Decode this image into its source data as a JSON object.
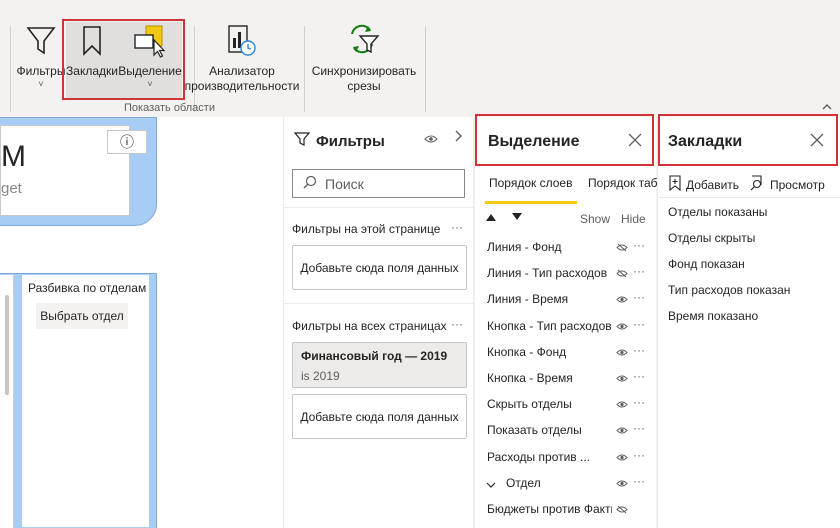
{
  "ribbon": {
    "filters_label": "Фильтры",
    "bookmarks_label": "Закладки",
    "selection_label": "Выделение",
    "analyzer_label_line1": "Анализатор",
    "analyzer_label_line2": "производительности",
    "sync_label_line1": "Синхронизировать",
    "sync_label_line2": "срезы",
    "group_label": "Показать области",
    "caret": "˅"
  },
  "canvas": {
    "card_big_text": "M",
    "card_sub_text": "get",
    "info_icon": "ⓘ",
    "slicer_title": "Разбивка по отделам",
    "slicer_button": "Выбрать отдел"
  },
  "filters": {
    "title": "Фильтры",
    "search_placeholder": "Поиск",
    "page_section": "Фильтры на этой странице",
    "all_section": "Фильтры на всех страницах",
    "dots": "···",
    "drop_hint": "Добавьте сюда поля данных",
    "card_title": "Финансовый год — 2019",
    "card_value": "is 2019"
  },
  "selection": {
    "title": "Выделение",
    "tab_layer_order": "Порядок слоев",
    "tab_tab_order": "Порядок табуляции",
    "show": "Show",
    "hide": "Hide",
    "rows": [
      {
        "name": "Линия - Фонд",
        "eye": "hidden"
      },
      {
        "name": "Линия - Тип расходов",
        "eye": "hidden"
      },
      {
        "name": "Линия - Время",
        "eye": "visible"
      },
      {
        "name": "Кнопка - Тип расходов",
        "eye": "visible"
      },
      {
        "name": "Кнопка - Фонд",
        "eye": "visible"
      },
      {
        "name": "Кнопка - Время",
        "eye": "visible"
      },
      {
        "name": "Скрыть отделы",
        "eye": "visible"
      },
      {
        "name": "Показать отделы",
        "eye": "visible"
      },
      {
        "name": "Расходы против ...",
        "eye": "visible"
      },
      {
        "name": "Отдел",
        "eye": "visible"
      },
      {
        "name": "Бюджеты против Факти...",
        "eye": "hidden"
      }
    ]
  },
  "bookmarks": {
    "title": "Закладки",
    "add_label": "Добавить",
    "view_label": "Просмотр",
    "items": [
      "Отделы показаны",
      "Отделы скрыты",
      "Фонд показан",
      "Тип расходов показан",
      "Время показано"
    ]
  },
  "colors": {
    "highlight_border": "#d13438",
    "tab_underline": "#f2c811",
    "card_blue": "#a8cdf5"
  }
}
